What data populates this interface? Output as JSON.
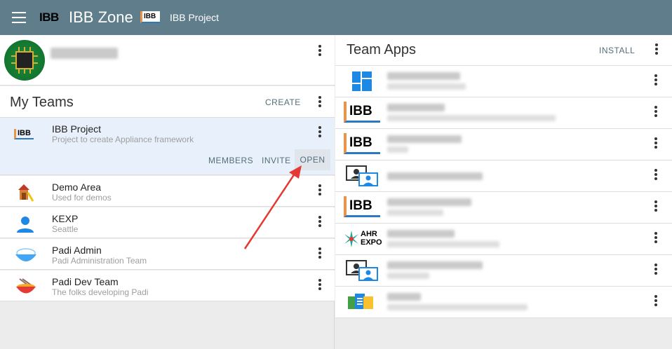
{
  "topbar": {
    "brand": "IBB",
    "title": "IBB Zone",
    "project_logo": "IBB",
    "project_name": "IBB Project"
  },
  "teams": {
    "title": "My Teams",
    "create_label": "CREATE",
    "items": [
      {
        "name": "IBB Project",
        "desc": "Project to create Appliance framework",
        "icon": "ibb-logo-icon"
      },
      {
        "name": "Demo Area",
        "desc": "Used for demos",
        "icon": "playground-icon"
      },
      {
        "name": "KEXP",
        "desc": "Seattle",
        "icon": "person-icon"
      },
      {
        "name": "Padi Admin",
        "desc": "Padi Administration Team",
        "icon": "rice-bowl-icon"
      },
      {
        "name": "Padi Dev Team",
        "desc": "The folks developing Padi",
        "icon": "noodle-bowl-icon"
      }
    ],
    "actions": {
      "members": "MEMBERS",
      "invite": "INVITE",
      "open": "OPEN"
    }
  },
  "apps": {
    "title": "Team Apps",
    "install_label": "INSTALL",
    "items": [
      {
        "icon": "dashboard-grid-icon"
      },
      {
        "icon": "ibb-logo-icon",
        "label": "IBB"
      },
      {
        "icon": "ibb-logo-icon",
        "label": "IBB"
      },
      {
        "icon": "contacts-icon"
      },
      {
        "icon": "ibb-logo-icon",
        "label": "IBB"
      },
      {
        "icon": "ahr-expo-icon",
        "label": "AHR EXPO"
      },
      {
        "icon": "contacts-icon"
      },
      {
        "icon": "google-docs-icon"
      }
    ]
  },
  "colors": {
    "topbar": "#607d8b",
    "selected_row": "#e8f1fb",
    "accent_arrow": "#e53935"
  }
}
